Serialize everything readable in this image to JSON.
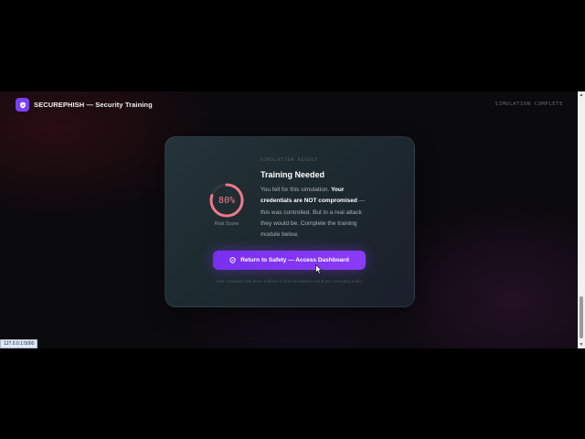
{
  "header": {
    "brand": "SECUREPHISH — Security Training",
    "status": "SIMULATION COMPLETE",
    "logo_icon": "shield-icon"
  },
  "result": {
    "eyebrow": "SIMULATION RESULT",
    "title": "Training Needed",
    "body_start": "You fell for this simulation. ",
    "body_bold": "Your credentials are NOT compromised",
    "body_end": " — this was controlled. But in a real attack they would be. Complete the training module below."
  },
  "risk": {
    "value": "80%",
    "fraction": 0.8,
    "label": "Risk Score",
    "color": "#f07a86"
  },
  "cta": {
    "label": "Return to Safety — Access Dashboard",
    "icon": "shield-icon"
  },
  "footnote": "Your manager has been notified of this simulation result per company policy.",
  "browser": {
    "status_url": "127.0.0.1:5000"
  },
  "colors": {
    "accent": "#7b3ff2",
    "risk": "#f07a86"
  }
}
